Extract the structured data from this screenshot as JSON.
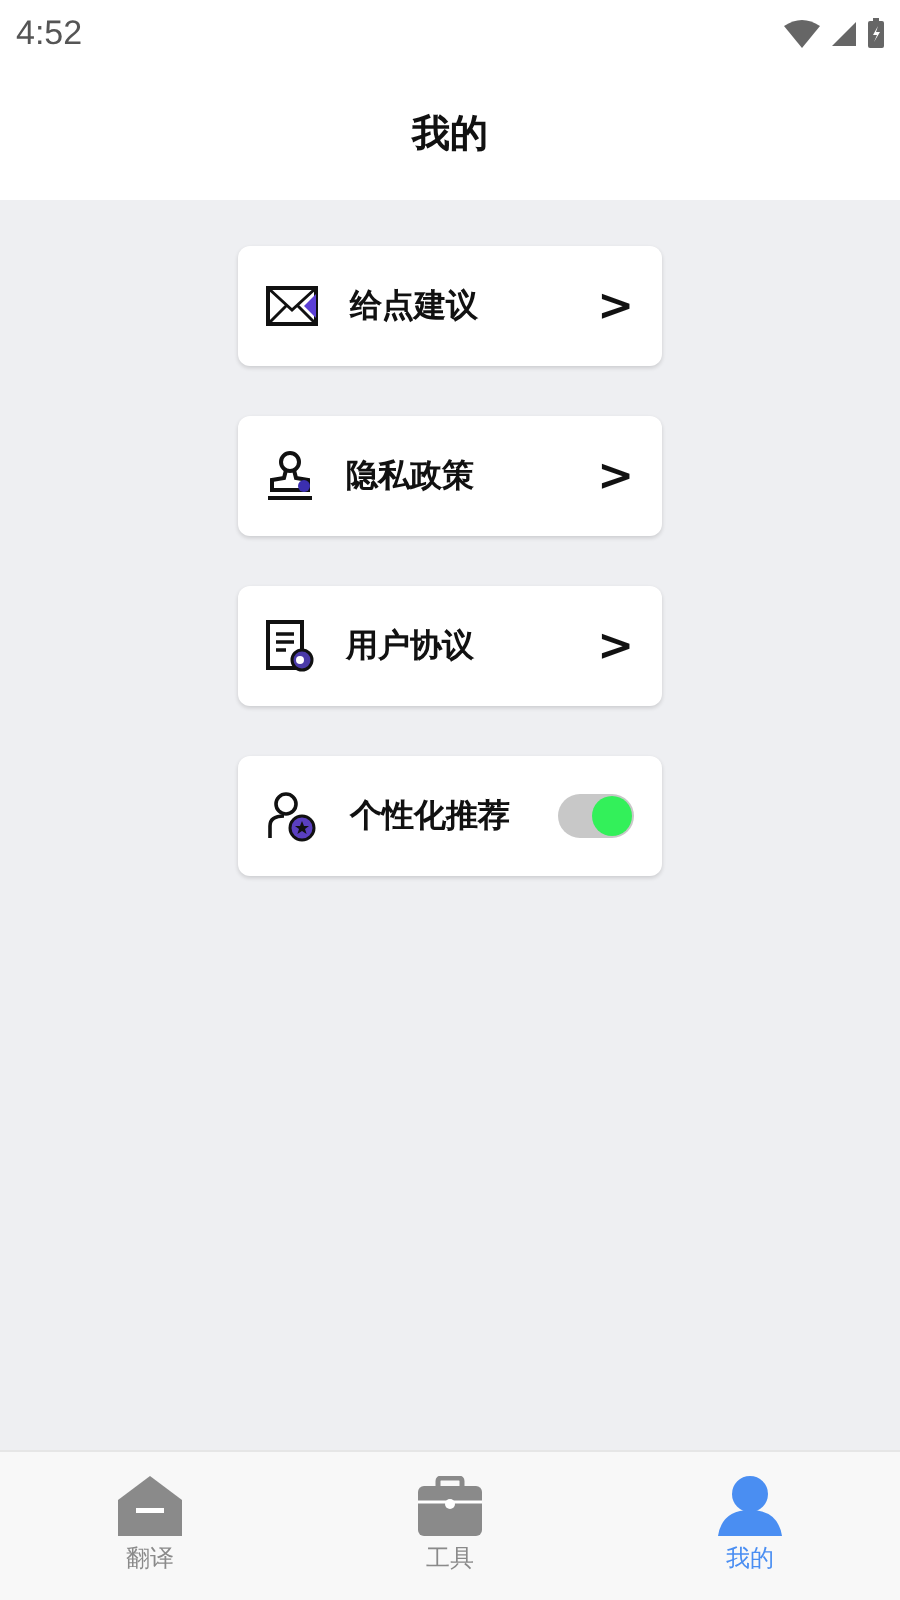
{
  "status_bar": {
    "time": "4:52"
  },
  "header": {
    "title": "我的"
  },
  "menu": [
    {
      "kind": "link",
      "label": "给点建议",
      "chevron": ">"
    },
    {
      "kind": "link",
      "label": "隐私政策",
      "chevron": ">"
    },
    {
      "kind": "link",
      "label": "用户协议",
      "chevron": ">"
    },
    {
      "kind": "toggle",
      "label": "个性化推荐",
      "on": true
    }
  ],
  "tabs": [
    {
      "label": "翻译",
      "selected": false
    },
    {
      "label": "工具",
      "selected": false
    },
    {
      "label": "我的",
      "selected": true
    }
  ]
}
